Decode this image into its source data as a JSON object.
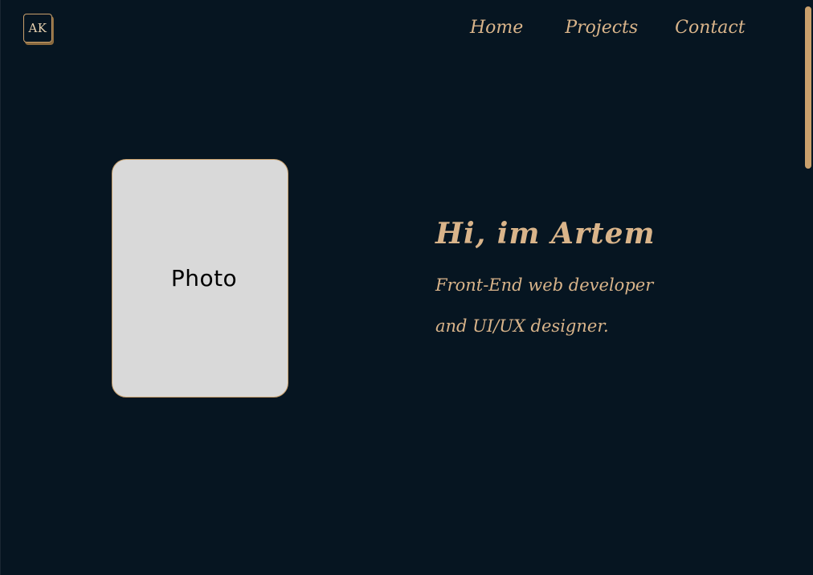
{
  "logo": {
    "text": "AK"
  },
  "nav": {
    "items": [
      {
        "label": "Home"
      },
      {
        "label": "Projects"
      },
      {
        "label": "Contact"
      }
    ]
  },
  "hero": {
    "photo_placeholder": "Photo",
    "title": "Hi, im Artem",
    "subtitle_line1": "Front-End web developer",
    "subtitle_line2": "and UI/UX designer."
  },
  "colors": {
    "background": "#061521",
    "accent": "#d9b48a",
    "photo_bg": "#d9d9d9"
  }
}
